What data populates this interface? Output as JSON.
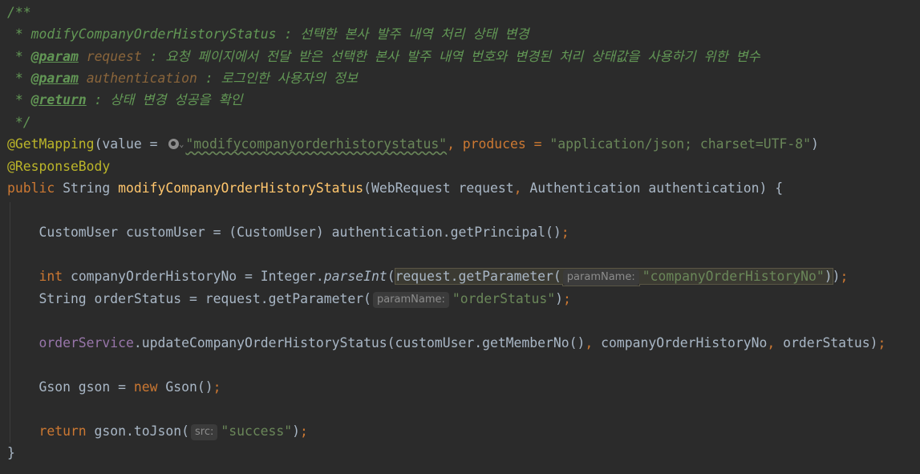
{
  "code": {
    "l1": {
      "text": "/**"
    },
    "l2": {
      "text": " * modifyCompanyOrderHistoryStatus : 선택한 본사 발주 내역 처리 상태 변경"
    },
    "l3": {
      "prefix": " * ",
      "tag": "@param",
      "name": " request",
      "desc": " : 요청 페이지에서 전달 받은 선택한 본사 발주 내역 번호와 변경된 처리 상태값을 사용하기 위한 변수"
    },
    "l4": {
      "prefix": " * ",
      "tag": "@param",
      "name": " authentication",
      "desc": " : 로그인한 사용자의 정보"
    },
    "l5": {
      "prefix": " * ",
      "tag": "@return",
      "desc": " : 상태 변경 성공을 확인"
    },
    "l6": {
      "text": " */"
    },
    "l7": {
      "ann": "@GetMapping",
      "open": "(value = ",
      "url": "\"modifycompanyorderhistorystatus\"",
      "comma": ", produces = ",
      "produces": "\"application/json; charset=UTF-8\"",
      "close": ")"
    },
    "l8": {
      "ann": "@ResponseBody"
    },
    "l9": {
      "kw": "public",
      "type": " String ",
      "fn": "modifyCompanyOrderHistoryStatus",
      "params": "(WebRequest request",
      "comma": ",",
      "params2": " Authentication authentication) {"
    },
    "l10": {
      "text": "    CustomUser customUser = (CustomUser) authentication.getPrincipal()",
      "semi": ";"
    },
    "l11": {
      "kw": "    int",
      "a": " companyOrderHistoryNo = Integer.",
      "fn": "parseInt",
      "b": "(",
      "hl_text": "request.getParameter(",
      "hint": "paramName:",
      "str": "\"companyOrderHistoryNo\"",
      "hl_close": ")",
      "c": ")",
      "semi": ";"
    },
    "l12": {
      "a": "    String orderStatus = request.getParameter(",
      "hint": "paramName:",
      "str": "\"orderStatus\"",
      "c": ")",
      "semi": ";"
    },
    "l13": {
      "field": "    orderService",
      "a": ".updateCompanyOrderHistoryStatus(customUser.getMemberNo()",
      "comma1": ",",
      "b": " companyOrderHistoryNo",
      "comma2": ",",
      "c": " orderStatus)",
      "semi": ";"
    },
    "l14": {
      "a": "    Gson gson = ",
      "kw": "new",
      "b": " Gson()",
      "semi": ";"
    },
    "l15": {
      "kw": "    return",
      "a": " gson.toJson(",
      "hint": "src:",
      "str": "\"success\"",
      "c": ")",
      "semi": ";"
    },
    "l16": {
      "text": "}"
    }
  },
  "colors": {
    "background": "#2b2b2b",
    "default_text": "#a9b7c6",
    "comment": "#629755",
    "keyword": "#cc7832",
    "string": "#6a8759",
    "annotation": "#bbb529",
    "method_decl": "#ffc66d",
    "field": "#9876aa"
  }
}
